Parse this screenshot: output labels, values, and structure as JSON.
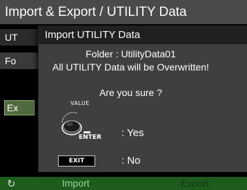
{
  "screen": {
    "title": "Import & Export / UTILITY Data",
    "row1_fragment": "UT",
    "row2_fragment": "Fo",
    "side_button_fragment": "Ex"
  },
  "footer": {
    "icon": "refresh-icon",
    "import_label": "Import",
    "export_label": "Export"
  },
  "dialog": {
    "title": "Import UTILITY Data",
    "folder_line": "Folder : UtilityData01",
    "warning_line": "All UTILITY Data will be Overwritten!",
    "question": "Are you sure ?",
    "value_label": "VALUE",
    "enter_label": "ENTER",
    "yes_label": ": Yes",
    "exit_label": "EXIT",
    "no_label": ": No"
  },
  "colors": {
    "header_bg": "#4a4a4a",
    "dialog_bg": "#3f3f3f",
    "dialog_title_bg": "#202020",
    "footer_bg": "#1e5c1e",
    "footer_import": "#9bd39b"
  }
}
